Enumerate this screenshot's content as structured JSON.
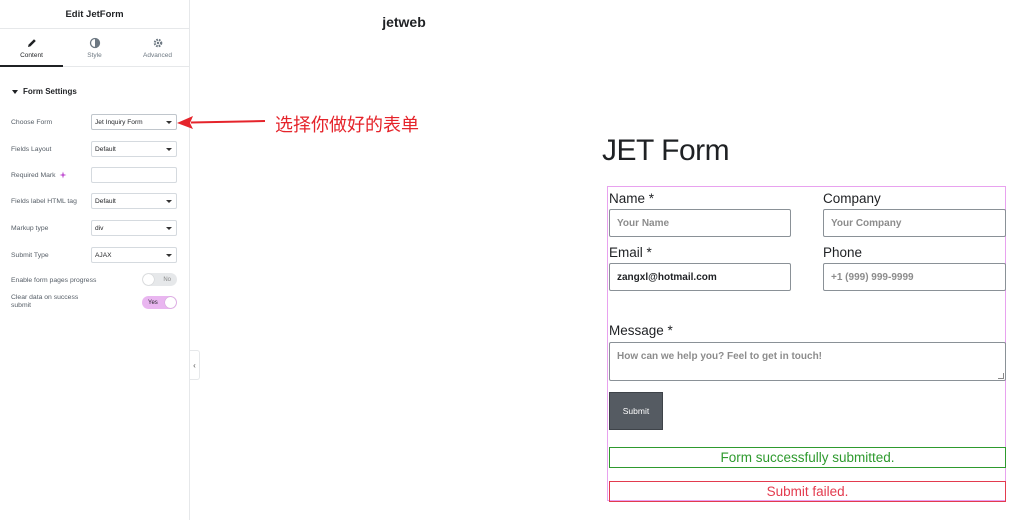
{
  "panel": {
    "title": "Edit JetForm",
    "tabs": [
      {
        "label": "Content",
        "icon": "pencil-icon",
        "active": true
      },
      {
        "label": "Style",
        "icon": "half-circle-icon",
        "active": false
      },
      {
        "label": "Advanced",
        "icon": "gear-icon",
        "active": false
      }
    ],
    "section_title": "Form Settings",
    "settings": {
      "choose_form": {
        "label": "Choose Form",
        "value": "Jet Inquiry Form"
      },
      "fields_layout": {
        "label": "Fields Layout",
        "value": "Default"
      },
      "required_mark": {
        "label": "Required Mark",
        "value": ""
      },
      "fields_label_tag": {
        "label": "Fields label HTML tag",
        "value": "Default"
      },
      "markup_type": {
        "label": "Markup type",
        "value": "div"
      },
      "submit_type": {
        "label": "Submit Type",
        "value": "AJAX"
      },
      "enable_progress": {
        "label": "Enable form pages progress",
        "value": "No"
      },
      "clear_data": {
        "label": "Clear data on success submit",
        "value": "Yes"
      }
    },
    "accent_color": "#e9b6f0"
  },
  "annotation": {
    "text": "选择你做好的表单",
    "color": "#e5242b"
  },
  "preview": {
    "site_title": "jetweb",
    "form_heading": "JET Form",
    "fields": {
      "name": {
        "label": "Name *",
        "placeholder": "Your Name",
        "value": ""
      },
      "company": {
        "label": "Company",
        "placeholder": "Your Company",
        "value": ""
      },
      "email": {
        "label": "Email *",
        "placeholder": "",
        "value": "zangxl@hotmail.com"
      },
      "phone": {
        "label": "Phone",
        "placeholder": "+1 (999) 999-9999",
        "value": ""
      },
      "message": {
        "label": "Message *",
        "placeholder": "How can we help you? Feel to get in touch!",
        "value": ""
      }
    },
    "submit_label": "Submit",
    "success_message": "Form successfully submitted.",
    "fail_message": "Submit failed.",
    "success_color": "#2e9a2e",
    "fail_color": "#e33b4e"
  }
}
